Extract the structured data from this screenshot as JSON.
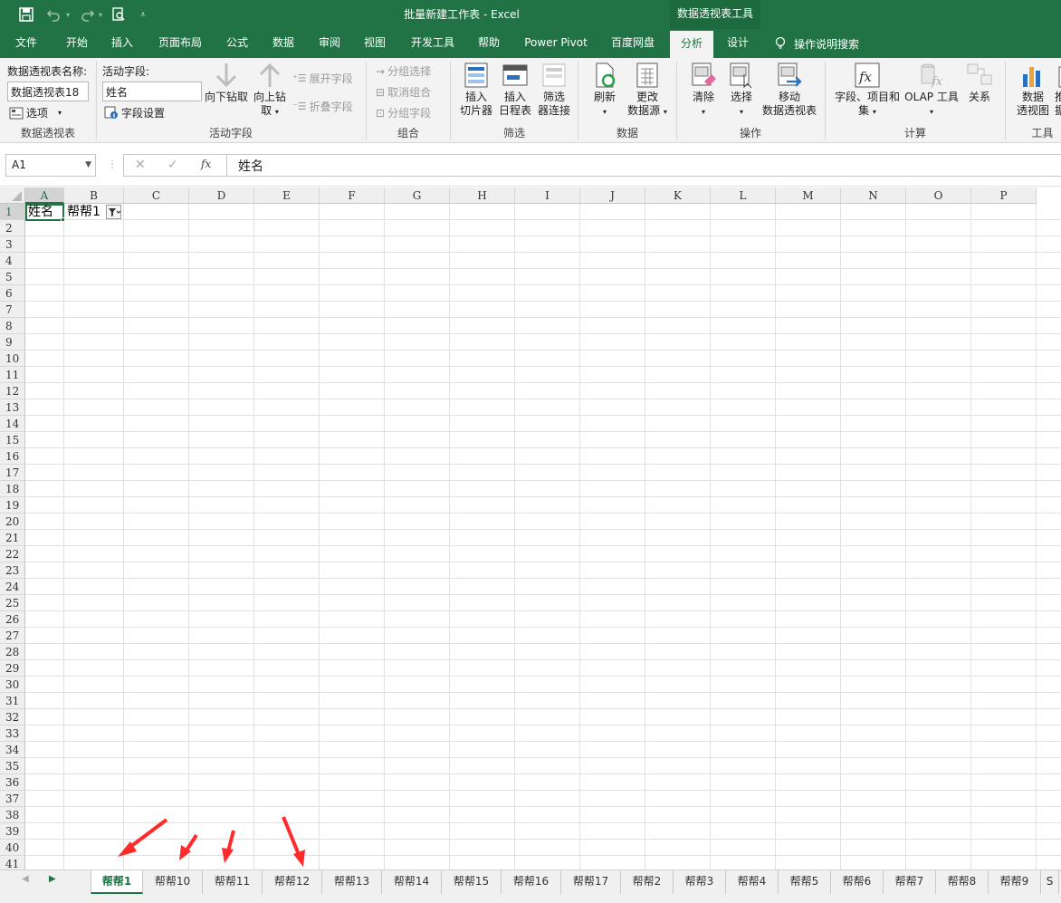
{
  "titlebar": {
    "document_title": "批量新建工作表  -  Excel",
    "contextual_title": "数据透视表工具",
    "quick_access": [
      "save-icon",
      "undo-icon",
      "redo-icon",
      "print-preview-icon",
      "customize-qat-icon"
    ]
  },
  "tabs": [
    {
      "label": "文件"
    },
    {
      "label": "开始"
    },
    {
      "label": "插入"
    },
    {
      "label": "页面布局"
    },
    {
      "label": "公式"
    },
    {
      "label": "数据"
    },
    {
      "label": "审阅"
    },
    {
      "label": "视图"
    },
    {
      "label": "开发工具"
    },
    {
      "label": "帮助"
    },
    {
      "label": "Power Pivot"
    },
    {
      "label": "百度网盘"
    },
    {
      "label": "分析",
      "active": true
    },
    {
      "label": "设计"
    }
  ],
  "tell_me": "操作说明搜索",
  "ribbon": {
    "pivot": {
      "name_label": "数据透视表名称:",
      "name_value": "数据透视表18",
      "options_label": "选项",
      "group_label": "数据透视表"
    },
    "active_field": {
      "label": "活动字段:",
      "value": "姓名",
      "settings_label": "字段设置",
      "drill_down": "向下钻取",
      "drill_up_1": "向上钻",
      "drill_up_2": "取",
      "expand": "展开字段",
      "collapse": "折叠字段",
      "group_label": "活动字段"
    },
    "group": {
      "group_selection": "分组选择",
      "ungroup": "取消组合",
      "group_field": "分组字段",
      "group_label": "组合"
    },
    "filter": {
      "slicer_1": "插入",
      "slicer_2": "切片器",
      "timeline_1": "插入",
      "timeline_2": "日程表",
      "connections_1": "筛选",
      "connections_2": "器连接",
      "group_label": "筛选"
    },
    "data": {
      "refresh": "刷新",
      "change_source_1": "更改",
      "change_source_2": "数据源",
      "group_label": "数据"
    },
    "actions": {
      "clear": "清除",
      "select": "选择",
      "move_1": "移动",
      "move_2": "数据透视表",
      "group_label": "操作"
    },
    "calc": {
      "fields_1": "字段、项目和",
      "fields_2": "集",
      "olap_1": "OLAP 工具",
      "relationships": "关系",
      "group_label": "计算"
    },
    "tools": {
      "chart_1": "数据",
      "chart_2": "透视图",
      "recommend_1": "推",
      "recommend_2": "据",
      "group_label": "工具"
    }
  },
  "formula_bar": {
    "name_box": "A1",
    "formula": "姓名"
  },
  "grid": {
    "columns": [
      "A",
      "B",
      "C",
      "D",
      "E",
      "F",
      "G",
      "H",
      "I",
      "J",
      "K",
      "L",
      "M",
      "N",
      "O",
      "P"
    ],
    "rows": [
      "1",
      "2",
      "3",
      "4",
      "5",
      "6",
      "7",
      "8",
      "9",
      "10",
      "11",
      "12",
      "13",
      "14",
      "15",
      "16",
      "17",
      "18",
      "19",
      "20",
      "21",
      "22",
      "23",
      "24",
      "25",
      "26",
      "27",
      "28",
      "29",
      "30",
      "31",
      "32",
      "33",
      "34",
      "35",
      "36",
      "37",
      "38",
      "39",
      "40",
      "41"
    ],
    "cell_a1": "姓名",
    "cell_b1": "帮帮1"
  },
  "sheet_tabs": [
    "帮帮1",
    "帮帮10",
    "帮帮11",
    "帮帮12",
    "帮帮13",
    "帮帮14",
    "帮帮15",
    "帮帮16",
    "帮帮17",
    "帮帮2",
    "帮帮3",
    "帮帮4",
    "帮帮5",
    "帮帮6",
    "帮帮7",
    "帮帮8",
    "帮帮9",
    "S"
  ],
  "active_sheet": "帮帮1",
  "colors": {
    "excel_green": "#217346",
    "annotation_red": "#ff2a2a"
  }
}
